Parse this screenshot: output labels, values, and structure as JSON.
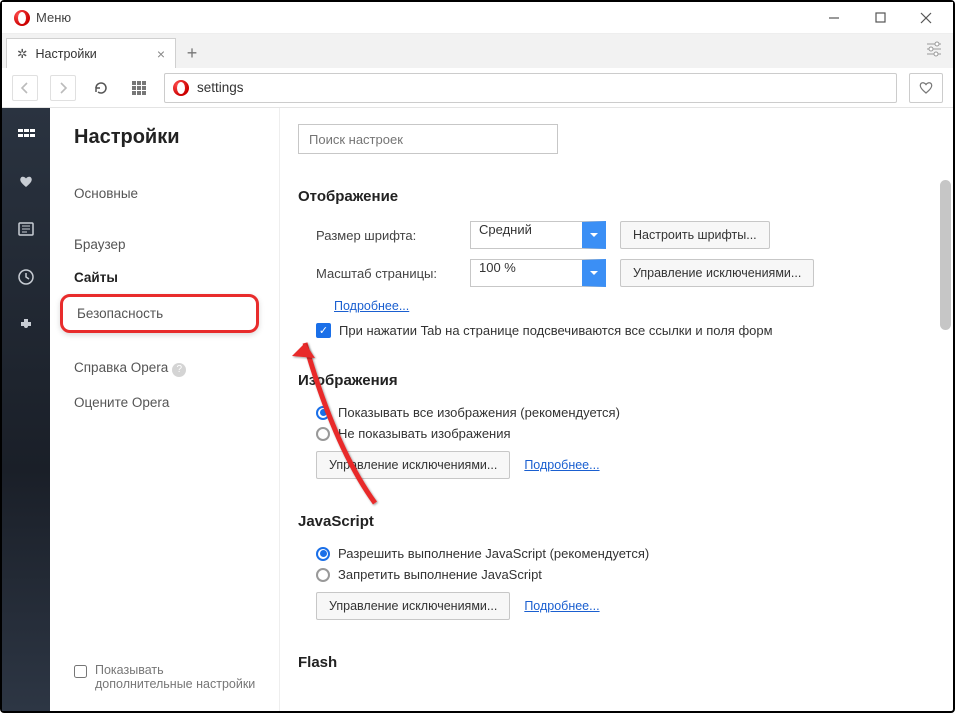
{
  "window": {
    "menu_label": "Меню"
  },
  "tab": {
    "title": "Настройки"
  },
  "addressbar": {
    "url_text": "settings"
  },
  "sidebar": {
    "title": "Настройки",
    "items": {
      "basic": "Основные",
      "browser": "Браузер",
      "sites": "Сайты",
      "security": "Безопасность",
      "help": "Справка Opera",
      "rate": "Оцените Opera"
    },
    "advanced_checkbox": "Показывать дополнительные настройки"
  },
  "settings": {
    "search_placeholder": "Поиск настроек",
    "display": {
      "title": "Отображение",
      "font_size_label": "Размер шрифта:",
      "font_size_value": "Средний",
      "font_button": "Настроить шрифты...",
      "zoom_label": "Масштаб страницы:",
      "zoom_value": "100 %",
      "zoom_button": "Управление исключениями...",
      "more_link": "Подробнее...",
      "tab_highlight": "При нажатии Tab на странице подсвечиваются все ссылки и поля форм"
    },
    "images": {
      "title": "Изображения",
      "show_all": "Показывать все изображения (рекомендуется)",
      "hide_all": "Не показывать изображения",
      "exceptions": "Управление исключениями...",
      "more": "Подробнее..."
    },
    "javascript": {
      "title": "JavaScript",
      "allow": "Разрешить выполнение JavaScript (рекомендуется)",
      "deny": "Запретить выполнение JavaScript",
      "exceptions": "Управление исключениями...",
      "more": "Подробнее..."
    },
    "flash": {
      "title": "Flash"
    }
  }
}
